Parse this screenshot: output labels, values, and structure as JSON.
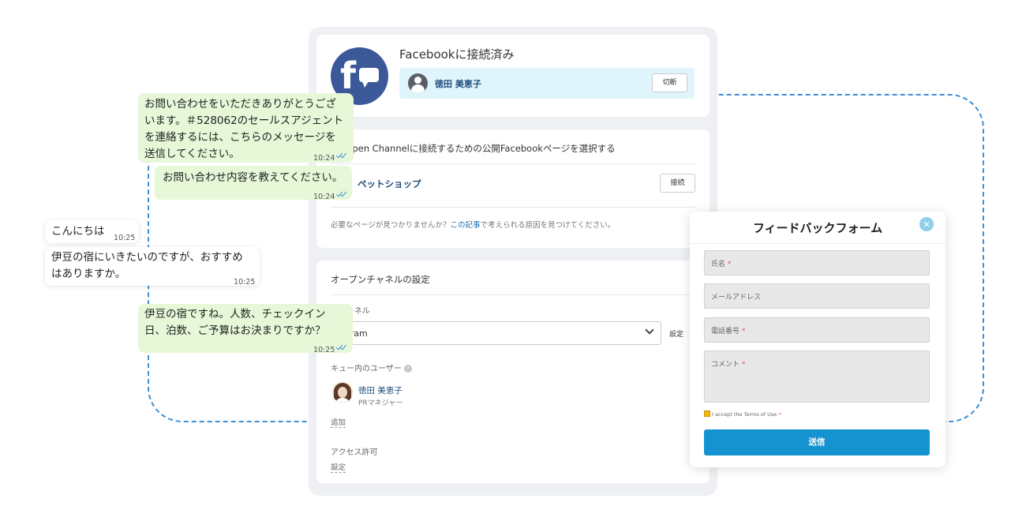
{
  "facebook_card": {
    "title": "Facebookに接続済み",
    "user_name": "徳田 美恵子",
    "disconnect_label": "切断"
  },
  "page_card": {
    "header": "24 Open Channelに接続するための公開Facebookページを選択する",
    "page_name": "ペットショップ",
    "connect_label": "接続",
    "hint_before": "必要なページが見つかりませんか？",
    "hint_link": "この記事",
    "hint_after": "で考えられる原因を見つけてください。"
  },
  "settings_card": {
    "header": "オープンチャネルの設定",
    "channel_label": "ンチャネル",
    "channel_value": "agram",
    "set_label": "設定",
    "queue_label": "キュー内のユーザー",
    "queue_user_name": "徳田 美恵子",
    "queue_user_role": "PRマネジャー",
    "add_label": "追加",
    "access_label": "アクセス許可",
    "access_set_label": "設定"
  },
  "chat": {
    "messages": [
      {
        "lines": [
          "お問い合わせをいただきありがとうござ",
          "います。＃528062のセールスアジェント",
          "を連絡するには、こちらのメッセージを",
          "送信してください。"
        ],
        "time": "10:24"
      },
      {
        "lines": [
          "お問い合わせ内容を教えてください。"
        ],
        "time": "10:24"
      },
      {
        "lines": [
          "こんにちは"
        ],
        "time": "10:25"
      },
      {
        "lines": [
          "伊豆の宿にいきたいのですが、おすすめ",
          "はありますか。"
        ],
        "time": "10:25"
      },
      {
        "lines": [
          "伊豆の宿ですね。人数、チェックイン",
          "日、泊数、ご予算はお決まりですか？"
        ],
        "time": "10:25"
      }
    ]
  },
  "feedback_form": {
    "title": "フィードバックフォーム",
    "close_glyph": "×",
    "name_placeholder": "氏名",
    "email_placeholder": "メールアドレス",
    "phone_placeholder": "電話番号",
    "comment_placeholder": "コメント",
    "required_mark": "*",
    "terms_text": "I accept the Terms of Use",
    "submit_label": "送信"
  },
  "colors": {
    "facebook_blue": "#3b5998",
    "bubble_green": "#e6f8d8",
    "submit_blue": "#1593d0",
    "dashed_frame": "#3d8fd8"
  },
  "icons": {
    "logo": "facebook-messenger-icon",
    "user_avatar": "user-avatar-icon",
    "help": "help-icon",
    "dropdown": "chevron-down-icon",
    "read_receipt": "double-check-icon",
    "close": "close-icon"
  }
}
